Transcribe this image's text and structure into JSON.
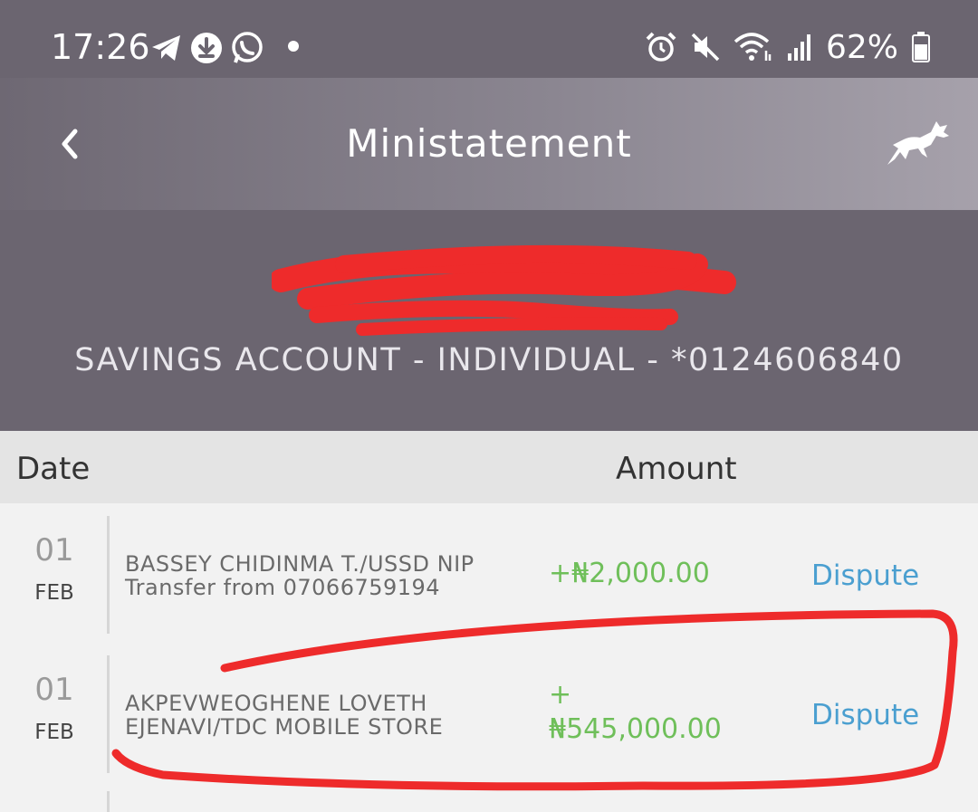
{
  "status_bar": {
    "time": "17:26",
    "left_icons": [
      "telegram-icon",
      "download-icon",
      "whatsapp-icon"
    ],
    "right_icons": [
      "alarm-icon",
      "mute-icon",
      "wifi-icon",
      "signal-icon"
    ],
    "battery_percent": "62%"
  },
  "app_bar": {
    "title": "Ministatement",
    "back_icon": "chevron-left-icon",
    "logo_icon": "horse-icon"
  },
  "account": {
    "label": "SAVINGS ACCOUNT - INDIVIDUAL - *0124606840"
  },
  "table": {
    "header_date": "Date",
    "header_amount": "Amount",
    "rows": [
      {
        "day": "01",
        "month": "FEB",
        "desc_line1": "BASSEY  CHIDINMA T./USSD NIP",
        "desc_line2": "Transfer from  07066759194",
        "amount": "+₦2,000.00",
        "action": "Dispute"
      },
      {
        "day": "01",
        "month": "FEB",
        "desc_line1": "AKPEVWEOGHENE LOVETH",
        "desc_line2": "EJENAVI/TDC MOBILE STORE",
        "amount_sign": "+",
        "amount": "₦545,000.00",
        "action": "Dispute"
      }
    ]
  },
  "colors": {
    "header_bg": "#6b6570",
    "amount_green": "#6fbf5a",
    "dispute_blue": "#4a9fd0",
    "annotation_red": "#ee2b2b"
  }
}
